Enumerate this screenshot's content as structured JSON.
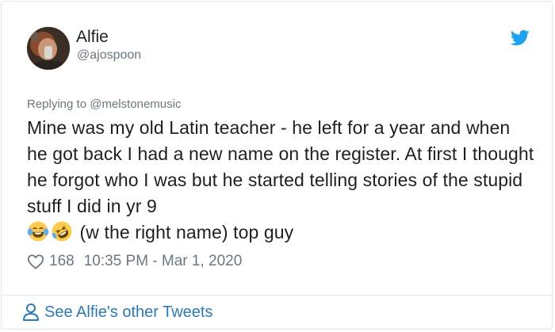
{
  "author": {
    "name": "Alfie",
    "handle": "@ajospoon"
  },
  "reply": {
    "prefix": "Replying to ",
    "mention": "@melstonemusic"
  },
  "tweet": {
    "text": "Mine was my old Latin teacher - he left for a year and when he got back I had a new name on the register. At first I thought he forgot who I was but he started telling stories of the stupid stuff I did in yr 9",
    "emojis": [
      "face-with-tears-of-joy-icon",
      "rolling-on-the-floor-laughing-icon"
    ],
    "tail": " (w the right name) top guy"
  },
  "meta": {
    "likes": "168",
    "timestamp": "10:35 PM - Mar 1, 2020"
  },
  "footer": {
    "see_more": "See Alfie's other Tweets"
  },
  "icons": {
    "brand": "twitter-bird-icon",
    "like": "heart-icon",
    "profile": "person-icon"
  },
  "colors": {
    "twitter_blue": "#1da1f2",
    "link_blue": "#2b7bb9",
    "secondary_text": "#697882"
  }
}
